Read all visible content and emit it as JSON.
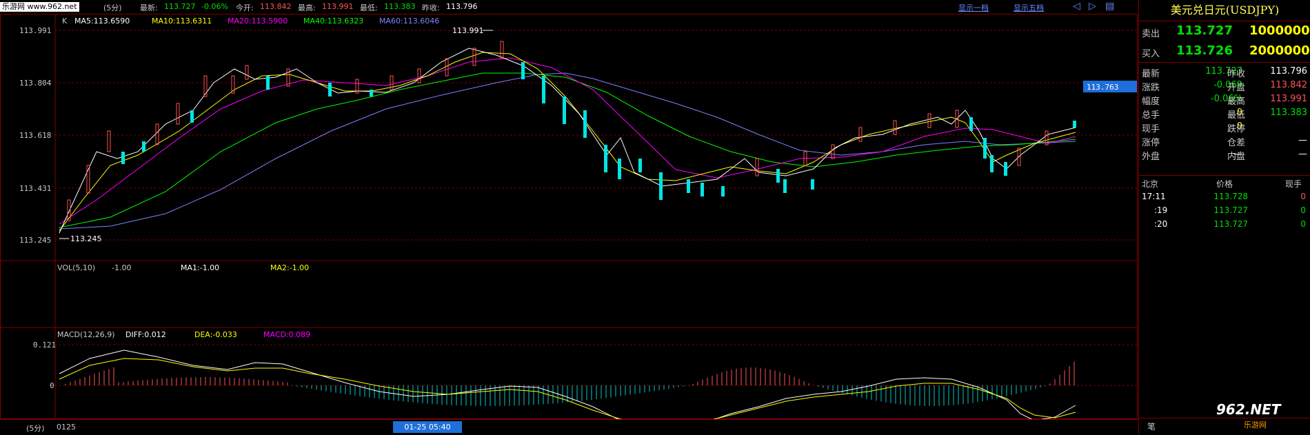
{
  "topbar": {
    "watermark": "乐游网 www.962.net",
    "period": "(5分)",
    "latest_label": "最新:",
    "latest_value": "113.727",
    "change": "-0.06%",
    "open_label": "今开:",
    "open_value": "113.842",
    "high_label": "最高:",
    "high_value": "113.991",
    "low_label": "最低:",
    "low_value": "113.383",
    "prev_label": "昨收:",
    "prev_value": "113.796",
    "link_one": "显示一档",
    "link_five": "显示五档"
  },
  "main_chart": {
    "k_label": "K",
    "ma": [
      {
        "label": "MA5:113.6590",
        "color": "#ffffff"
      },
      {
        "label": "MA10:113.6311",
        "color": "#ffff00"
      },
      {
        "label": "MA20:113.5900",
        "color": "#ff00ff"
      },
      {
        "label": "MA40:113.6323",
        "color": "#00ff00"
      },
      {
        "label": "MA60:113.6046",
        "color": "#8080ff"
      }
    ],
    "y_ticks": [
      "113.991",
      "113.804",
      "113.618",
      "113.431",
      "113.245"
    ],
    "high_mark": "113.991",
    "low_mark": "113.245",
    "current_price_tag": "113.763"
  },
  "volume": {
    "label": "VOL(5,10)",
    "value": "-1.00",
    "ma1": "MA1:-1.00",
    "ma2": "MA2:-1.00"
  },
  "macd": {
    "label": "MACD(12,26,9)",
    "diff": "DIFF:0.012",
    "dea": "DEA:-0.033",
    "macd": "MACD:0.089",
    "y_top": "0.121",
    "y_zero": "0"
  },
  "bottom": {
    "period": "(5分)",
    "date_left": "0125",
    "cursor_time": "01-25 05:40"
  },
  "quote": {
    "title": "美元兑日元(USDJPY)",
    "sell_label": "卖出",
    "sell_price": "113.727",
    "sell_vol": "1000000",
    "buy_label": "买入",
    "buy_price": "113.726",
    "buy_vol": "2000000",
    "rows": [
      {
        "l1": "最新",
        "v1": "113.727",
        "c1": "#00e000",
        "l2": "昨收",
        "v2": "113.796",
        "c2": "#ffffff"
      },
      {
        "l1": "涨跌",
        "v1": "-0.069",
        "c1": "#00e000",
        "l2": "开盘",
        "v2": "113.842",
        "c2": "#ff5555"
      },
      {
        "l1": "幅度",
        "v1": "-0.06%",
        "c1": "#00e000",
        "l2": "最高",
        "v2": "113.991",
        "c2": "#ff5555"
      },
      {
        "l1": "总手",
        "v1": "0",
        "c1": "#ffff00",
        "l2": "最低",
        "v2": "113.383",
        "c2": "#00e000"
      },
      {
        "l1": "现手",
        "v1": "0",
        "c1": "#ffff00",
        "l2": "跌停",
        "v2": "",
        "c2": "#ffffff"
      },
      {
        "l1": "涨停",
        "v1": "",
        "c1": "#ffffff",
        "l2": "仓差",
        "v2": "—",
        "c2": "#ffffff"
      },
      {
        "l1": "外盘",
        "v1": "—",
        "c1": "#ffffff",
        "l2": "内盘",
        "v2": "—",
        "c2": "#ffffff"
      }
    ],
    "ticks_header": {
      "place": "北京",
      "price": "价格",
      "hands": "现手"
    },
    "ticks": [
      {
        "time": "17:11",
        "price": "113.728",
        "hands": "0"
      },
      {
        "time": ":19",
        "price": "113.727",
        "hands": "0"
      },
      {
        "time": ":20",
        "price": "113.727",
        "hands": "0"
      }
    ],
    "footer_label": "笔",
    "logo_text": "962.NET",
    "logo_sub": "乐游网"
  }
}
